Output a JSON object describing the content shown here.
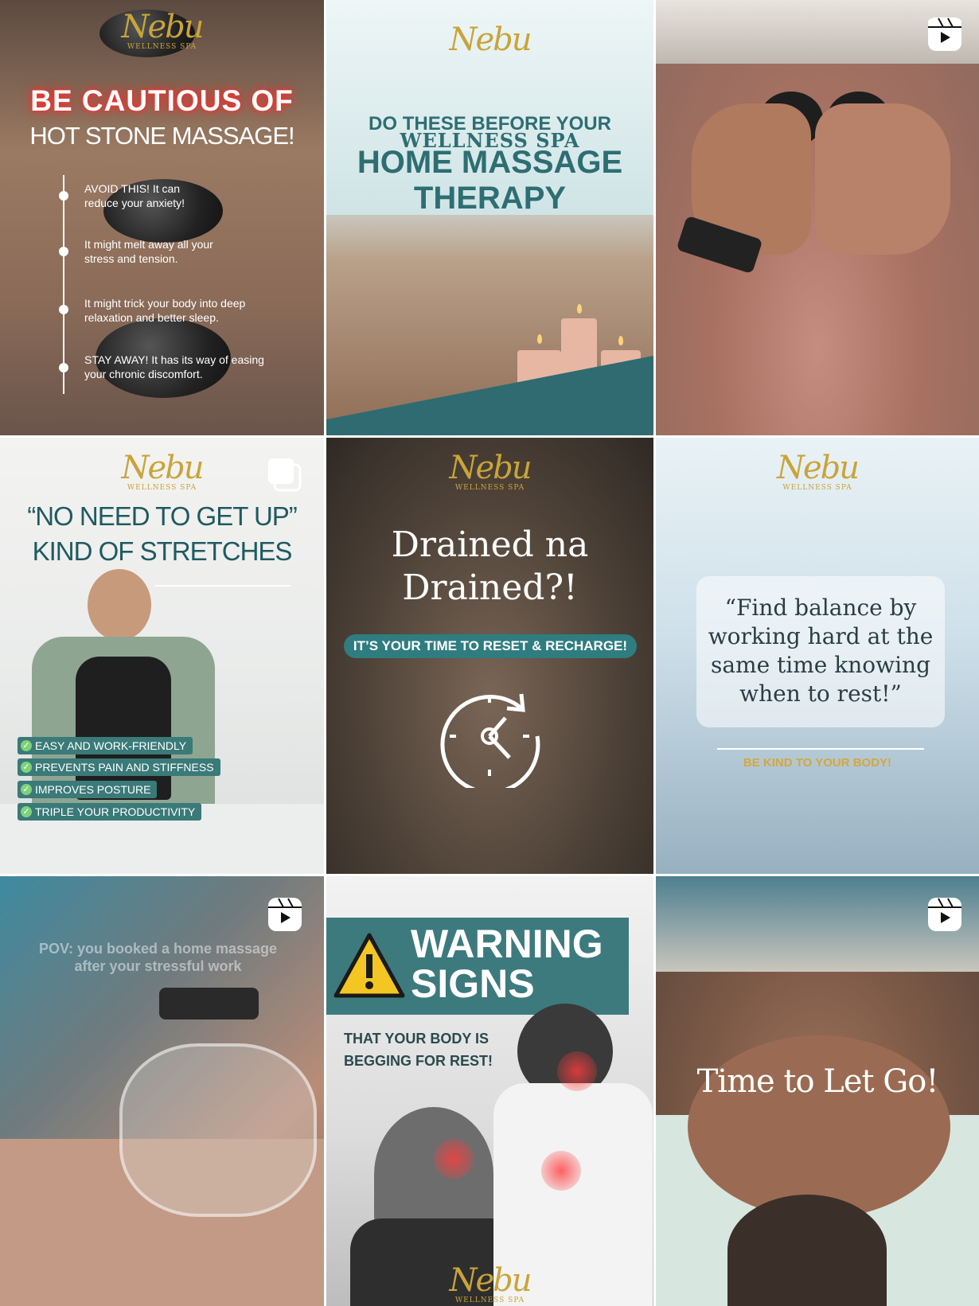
{
  "brand": {
    "logo_mark": "Nebu",
    "logo_sub": "WELLNESS SPA",
    "gold": "#c9a43a",
    "teal": "#2e6e73"
  },
  "posts": [
    {
      "type": "carousel-image",
      "title_highlight": "BE CAUTIOUS OF",
      "title_line2": "HOT STONE MASSAGE!",
      "items": [
        "AVOID THIS! It can reduce your anxiety!",
        "It might melt away all your stress and tension.",
        "It might trick your body into deep relaxation and better sleep.",
        "STAY AWAY! It has its way of easing your chronic discomfort."
      ]
    },
    {
      "type": "image",
      "subtitle": "DO THESE BEFORE YOUR",
      "title_line1": "HOME MASSAGE",
      "title_line2": "THERAPY"
    },
    {
      "type": "reel",
      "icon": "reel-icon"
    },
    {
      "type": "carousel",
      "icon": "carousel-icon",
      "title_line1": "“NO NEED TO GET UP”",
      "title_line2": "KIND OF STRETCHES",
      "checks": [
        "EASY AND WORK-FRIENDLY",
        "PREVENTS PAIN AND STIFFNESS",
        "IMPROVES POSTURE",
        "TRIPLE YOUR PRODUCTIVITY"
      ]
    },
    {
      "type": "image",
      "title_line1": "Drained na",
      "title_line2": "Drained?!",
      "banner": "IT’S YOUR TIME TO RESET & RECHARGE!"
    },
    {
      "type": "image",
      "quote": "“Find balance by working hard at the same time knowing when to rest!”",
      "tagline": "BE KIND TO YOUR BODY!"
    },
    {
      "type": "reel",
      "icon": "reel-icon",
      "caption": "POV: you booked a home massage after your stressful work"
    },
    {
      "type": "image",
      "title_line1": "WARNING",
      "title_line2": "SIGNS",
      "subtitle_line1": "THAT YOUR BODY IS",
      "subtitle_line2": "BEGGING FOR REST!"
    },
    {
      "type": "reel",
      "icon": "reel-icon",
      "title": "Time to Let Go!"
    }
  ]
}
